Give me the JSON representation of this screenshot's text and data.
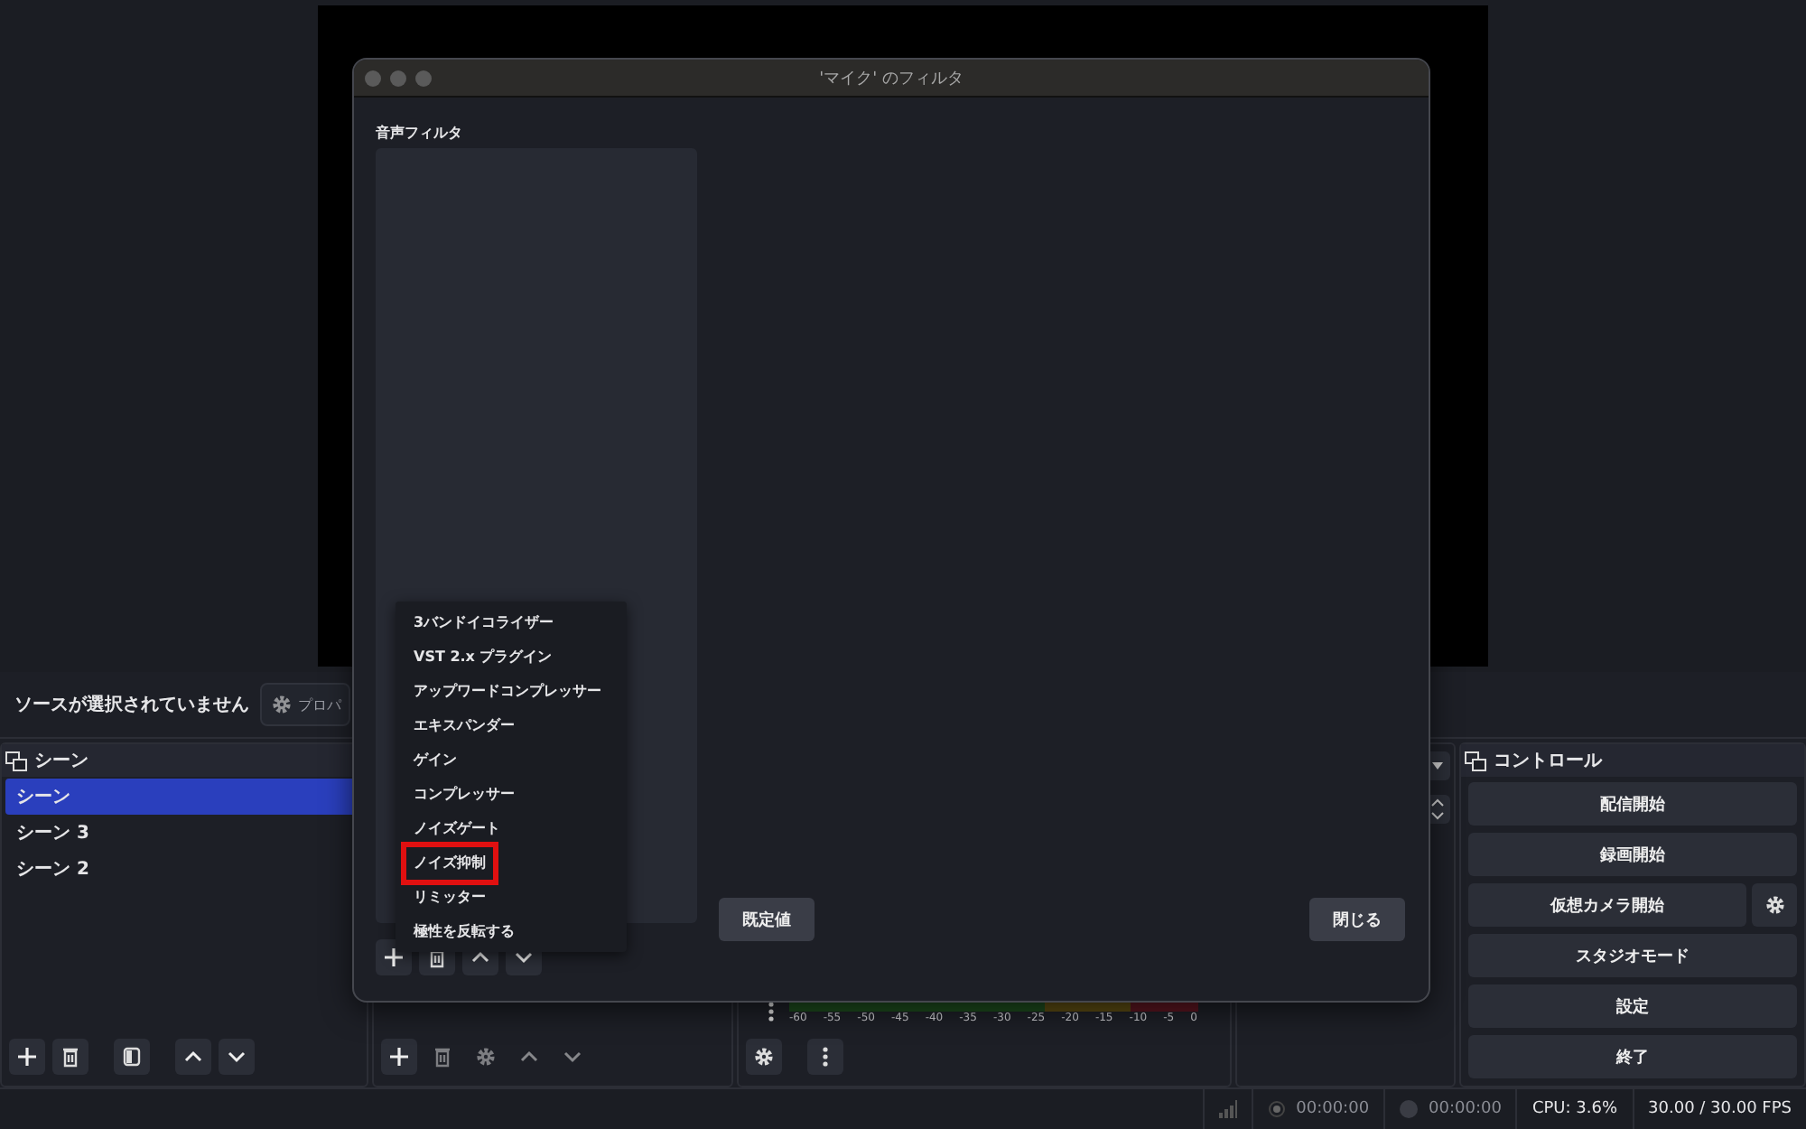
{
  "source_bar": {
    "message": "ソースが選択されていません",
    "properties_button": "プロパ"
  },
  "scenes_dock": {
    "title": "シーン",
    "items": [
      {
        "label": "シーン",
        "selected": true
      },
      {
        "label": "シーン 3",
        "selected": false
      },
      {
        "label": "シーン 2",
        "selected": false
      }
    ]
  },
  "mixer": {
    "meter_scale": [
      "-60",
      "-55",
      "-50",
      "-45",
      "-40",
      "-35",
      "-30",
      "-25",
      "-20",
      "-15",
      "-10",
      "-5",
      "0"
    ]
  },
  "controls_dock": {
    "title": "コントロール",
    "buttons": [
      {
        "label": "配信開始",
        "kind": "plain"
      },
      {
        "label": "録画開始",
        "kind": "plain"
      },
      {
        "label": "仮想カメラ開始",
        "kind": "with_settings"
      },
      {
        "label": "スタジオモード",
        "kind": "plain"
      },
      {
        "label": "設定",
        "kind": "plain"
      },
      {
        "label": "終了",
        "kind": "plain"
      }
    ]
  },
  "status_bar": {
    "stream_time": "00:00:00",
    "record_time": "00:00:00",
    "cpu": "CPU: 3.6%",
    "fps": "30.00 / 30.00 FPS"
  },
  "dialog": {
    "title": "'マイク' のフィルタ",
    "section_label": "音声フィルタ",
    "add_menu": [
      {
        "label": "3バンドイコライザー",
        "highlighted": false
      },
      {
        "label": "VST 2.x プラグイン",
        "highlighted": false
      },
      {
        "label": "アップワードコンプレッサー",
        "highlighted": false
      },
      {
        "label": "エキスパンダー",
        "highlighted": false
      },
      {
        "label": "ゲイン",
        "highlighted": false
      },
      {
        "label": "コンプレッサー",
        "highlighted": false
      },
      {
        "label": "ノイズゲート",
        "highlighted": false
      },
      {
        "label": "ノイズ抑制",
        "highlighted": true
      },
      {
        "label": "リミッター",
        "highlighted": false
      },
      {
        "label": "極性を反転する",
        "highlighted": false
      }
    ],
    "buttons": [
      {
        "label": "既定値"
      },
      {
        "label": "閉じる"
      }
    ]
  }
}
